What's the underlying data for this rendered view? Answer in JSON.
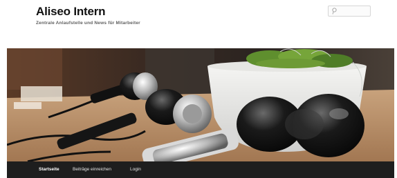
{
  "header": {
    "title": "Aliseo Intern",
    "tagline": "Zentrale Anlaufstelle und News für Mitarbeiter"
  },
  "search": {
    "placeholder": "",
    "icon": "search-icon"
  },
  "banner": {
    "image": "hair-dryers-on-table-with-plant-photo"
  },
  "nav": {
    "items": [
      "Startseite",
      "Beiträge einreichen",
      "Login"
    ],
    "active": "Startseite"
  },
  "colors": {
    "nav_background": "#1e1e1e",
    "title": "#111111",
    "tagline": "#5e5e5e"
  }
}
